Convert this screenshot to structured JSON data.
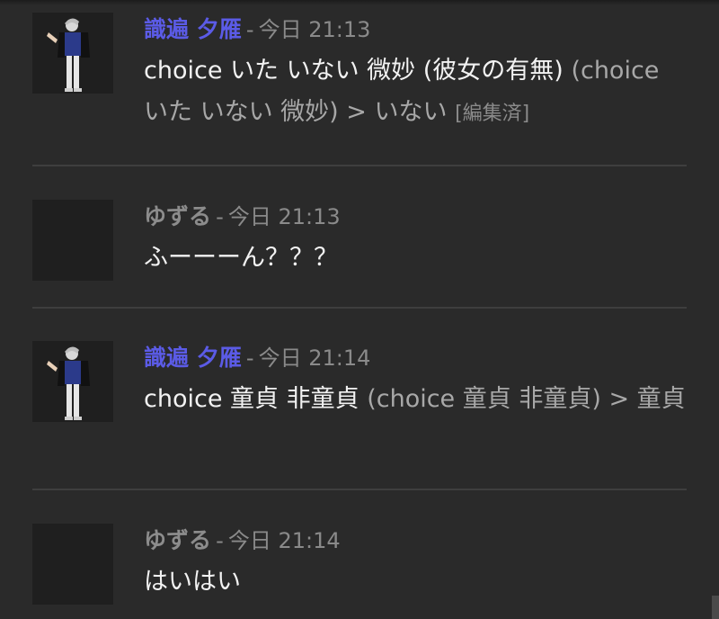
{
  "messages": [
    {
      "author": "識遍 夕雁",
      "author_style": "shiki",
      "sep": "-",
      "time": "今日 21:13",
      "text_main": "choice いた いない 微妙 (彼女の有無)",
      "text_dim": "(choice いた いない 微妙) > いない",
      "edited": "[編集済]"
    },
    {
      "author": "ゆずる",
      "author_style": "yuzuru",
      "sep": "-",
      "time": "今日 21:13",
      "text_main": "ふーーーん？？？"
    },
    {
      "author": "識遍 夕雁",
      "author_style": "shiki",
      "sep": "-",
      "time": "今日 21:14",
      "text_main": "choice 童貞 非童貞",
      "text_dim": "(choice 童貞 非童貞) > 童貞"
    },
    {
      "author": "ゆずる",
      "author_style": "yuzuru",
      "sep": "-",
      "time": "今日 21:14",
      "text_main": "はいはい"
    }
  ],
  "colors": {
    "background": "#2a2a2a",
    "author_shiki": "#5b5be6",
    "author_yuzuru": "#8c8c8c",
    "divider": "#3e3e3e"
  },
  "icons": {
    "character_avatar": "character-avatar-icon",
    "blank_avatar": "blank-avatar"
  }
}
